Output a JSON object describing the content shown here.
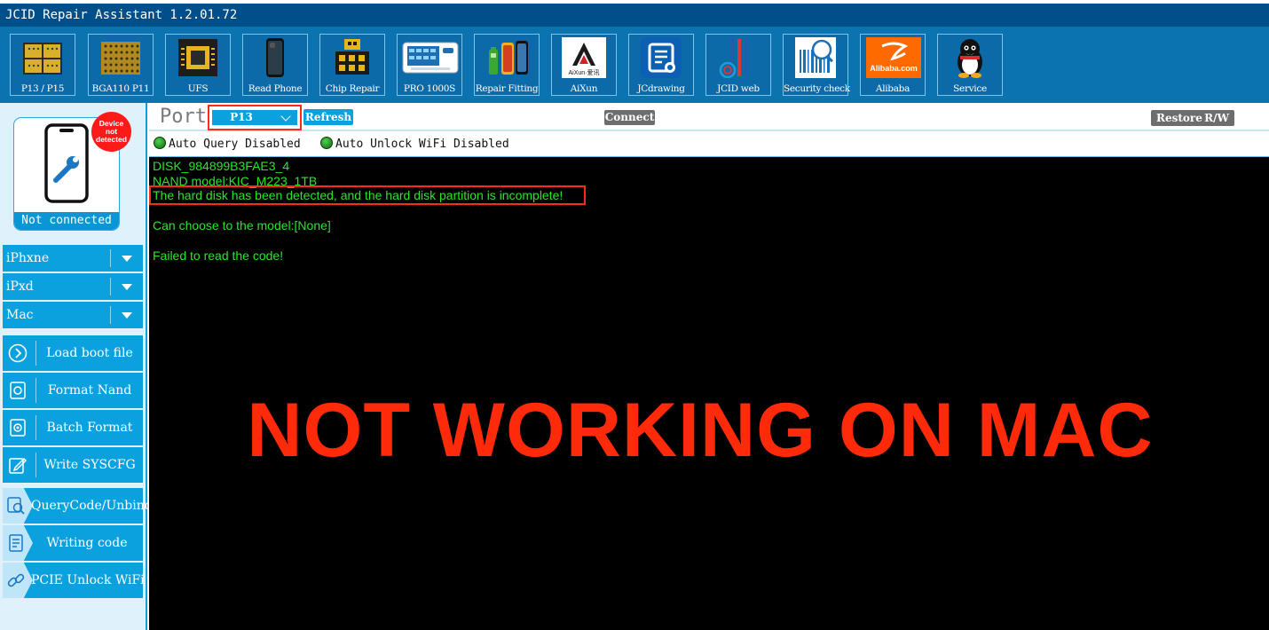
{
  "window": {
    "title": "JCID Repair Assistant 1.2.01.72"
  },
  "toolbar": {
    "items": [
      {
        "label": "P13 / P15",
        "icon": "chip-board-icon"
      },
      {
        "label": "BGA110 P11",
        "icon": "bga-chip-icon"
      },
      {
        "label": "UFS",
        "icon": "ufs-chip-icon"
      },
      {
        "label": "Read Phone",
        "icon": "phone-icon"
      },
      {
        "label": "Chip Repair",
        "icon": "chip-repair-icon"
      },
      {
        "label": "PRO 1000S",
        "icon": "programmer-device-icon"
      },
      {
        "label": "Repair Fitting",
        "icon": "battery-phone-icon"
      },
      {
        "label": "AiXun",
        "icon": "aixun-logo-icon"
      },
      {
        "label": "JCdrawing",
        "icon": "jcdrawing-logo-icon"
      },
      {
        "label": "JCID web",
        "icon": "jcid-web-icon"
      },
      {
        "label": "Security check",
        "icon": "security-check-icon"
      },
      {
        "label": "Alibaba",
        "icon": "alibaba-logo-icon"
      },
      {
        "label": "Service",
        "icon": "penguin-icon"
      }
    ],
    "logo_text": {
      "aixun": "AiXun·爱讯",
      "alibaba": "Alibaba.com"
    }
  },
  "sidebar": {
    "device_badge": "Device not detected",
    "device_status": "Not connected",
    "models": [
      {
        "label": "iPhxne"
      },
      {
        "label": "iPxd"
      },
      {
        "label": "Mac"
      }
    ],
    "functions": [
      {
        "label": "Load boot file",
        "icon": "arrow-circle-icon"
      },
      {
        "label": "Format Nand",
        "icon": "format-icon"
      },
      {
        "label": "Batch Format",
        "icon": "batch-format-icon"
      },
      {
        "label": "Write SYSCFG",
        "icon": "edit-icon"
      }
    ],
    "tabs": [
      {
        "label": "QueryCode/Unbind",
        "icon": "query-icon"
      },
      {
        "label": "Writing code",
        "icon": "document-icon"
      },
      {
        "label": "PCIE Unlock WiFi",
        "icon": "link-icon"
      }
    ]
  },
  "port_bar": {
    "label": "Port",
    "selected_port": "P13",
    "refresh_label": "Refresh",
    "connect_label": "Connect",
    "restore_label": "Restore",
    "rw_label": "R/W"
  },
  "status": {
    "auto_query": "Auto Query Disabled",
    "auto_unlock": "Auto Unlock WiFi Disabled"
  },
  "console": {
    "lines": [
      "DISK_984899B3FAE3_4",
      "NAND model:KIC_M223_1TB",
      "The hard disk has been detected, and the hard disk partition is incomplete!",
      "",
      "Can choose to the model:[None]",
      "",
      "Failed to read the code!"
    ],
    "overlay": "NOT WORKING ON MAC"
  },
  "colors": {
    "title_bar": "#004f8a",
    "toolbar": "#0a73b0",
    "accent": "#0aa1de",
    "console_text": "#28e628",
    "warning": "#ff2a0a"
  }
}
